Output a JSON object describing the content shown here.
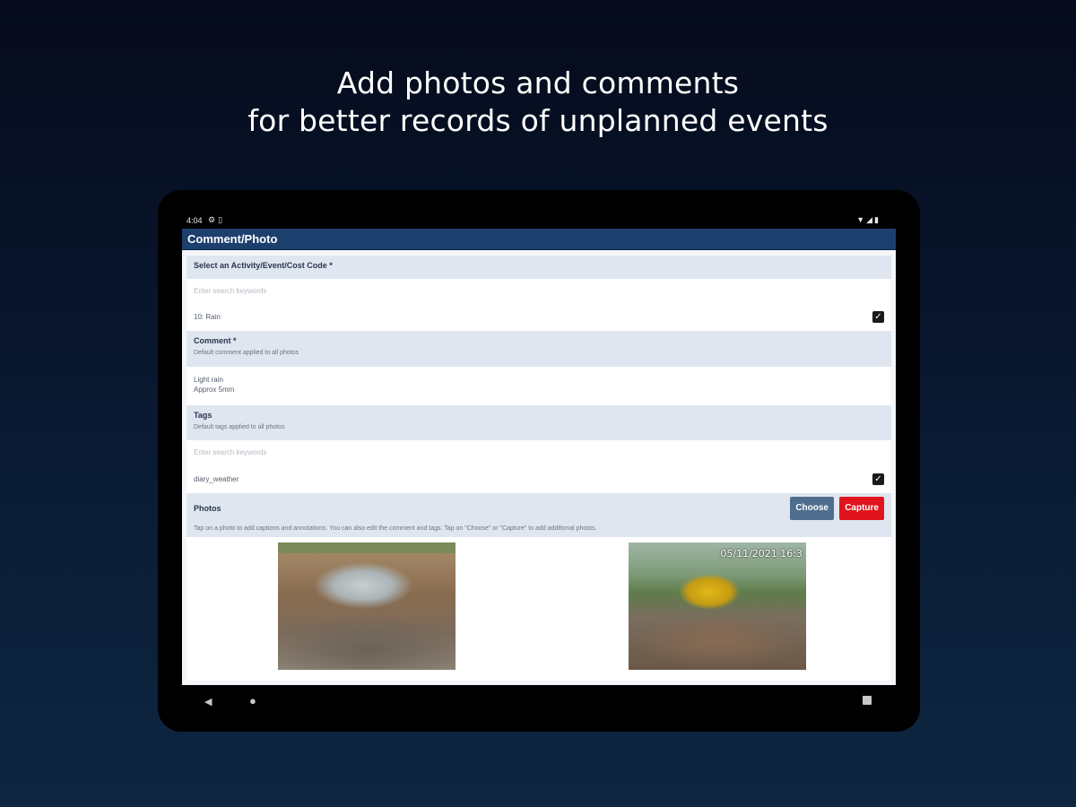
{
  "headline": {
    "line1": "Add photos and comments",
    "line2": "for better records of unplanned events"
  },
  "statusbar": {
    "time": "4:04",
    "left_icons": [
      "settings-icon",
      "battery-saver-icon"
    ],
    "right_icons": [
      "wifi-icon",
      "signal-icon",
      "battery-icon"
    ]
  },
  "app": {
    "title": "Comment/Photo",
    "accent_color": "#1d3f6e"
  },
  "activity": {
    "label": "Select an Activity/Event/Cost Code *",
    "search_placeholder": "Enter search keywords",
    "selected_item": "10: Rain",
    "selected_checked": true
  },
  "comment": {
    "label": "Comment *",
    "sublabel": "Default comment applied to all photos",
    "value_line1": "Light rain",
    "value_line2": "Approx 5mm"
  },
  "tags": {
    "label": "Tags",
    "sublabel": "Default tags applied to all photos",
    "search_placeholder": "Enter search keywords",
    "selected_item": "diary_weather",
    "selected_checked": true
  },
  "photos": {
    "label": "Photos",
    "hint": "Tap on a photo to add captions and annotations. You can also edit the comment and tags. Tap on \"Choose\" or \"Capture\" to add additional photos.",
    "choose_label": "Choose",
    "capture_label": "Capture",
    "choose_color": "#4f6e8f",
    "capture_color": "#e0141e",
    "items": [
      {
        "timestamp": ""
      },
      {
        "timestamp": "05/11/2021 16:3"
      }
    ]
  },
  "navbar": {
    "back_icon": "back-triangle-icon",
    "home_icon": "home-circle-icon",
    "recent_icon": "recents-square-icon"
  }
}
